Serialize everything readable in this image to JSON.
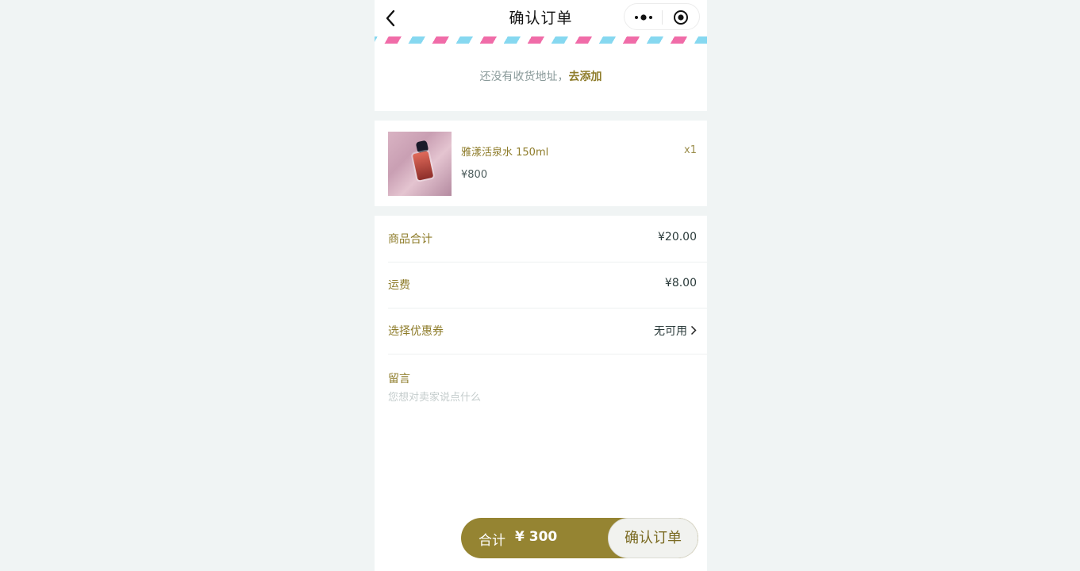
{
  "nav": {
    "title": "确认订单",
    "back_icon": "chevron-left-icon",
    "more_icon": "more-dots-icon",
    "close_icon": "target-circle-icon"
  },
  "address": {
    "empty_text": "还没有收货地址，",
    "add_link": "去添加"
  },
  "product": {
    "name": "雅漾活泉水 150ml",
    "price": "¥800",
    "quantity": "x1"
  },
  "summary": {
    "rows": [
      {
        "label": "商品合计",
        "value": "¥20.00"
      },
      {
        "label": "运费",
        "value": "¥8.00"
      },
      {
        "label": "选择优惠券",
        "value": "无可用"
      }
    ],
    "memo_label": "留言",
    "memo_placeholder": "您想对卖家说点什么"
  },
  "footer": {
    "total_label": "合计",
    "total_value": "¥ 300",
    "confirm_label": "确认订单"
  },
  "colors": {
    "accent": "#958432",
    "background": "#f0f4f4",
    "stripe_blue": "#86d8f0",
    "stripe_pink": "#f06ca8"
  }
}
